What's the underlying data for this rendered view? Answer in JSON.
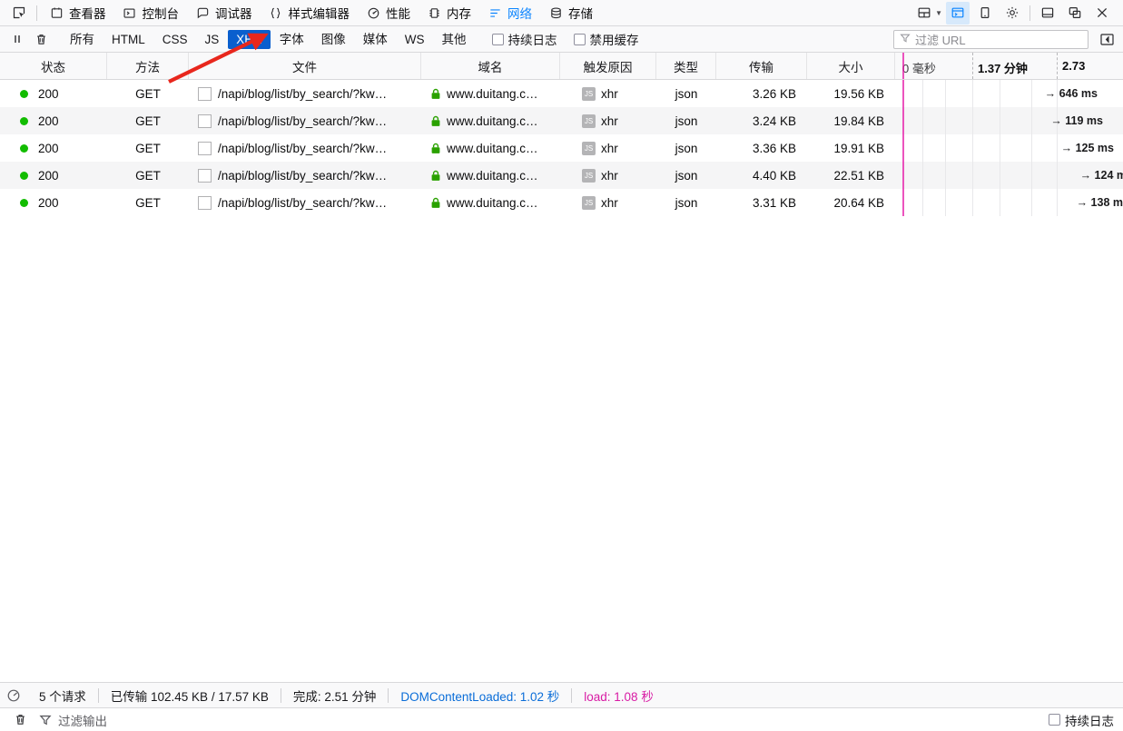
{
  "toolbar": {
    "picker_icon": "element-picker-icon",
    "tabs": [
      {
        "label": "查看器",
        "icon": "inspector-icon",
        "active": false
      },
      {
        "label": "控制台",
        "icon": "console-icon",
        "active": false
      },
      {
        "label": "调试器",
        "icon": "debugger-icon",
        "active": false
      },
      {
        "label": "样式编辑器",
        "icon": "style-editor-icon",
        "active": false
      },
      {
        "label": "性能",
        "icon": "performance-icon",
        "active": false
      },
      {
        "label": "内存",
        "icon": "memory-icon",
        "active": false
      },
      {
        "label": "网络",
        "icon": "network-icon",
        "active": true
      },
      {
        "label": "存储",
        "icon": "storage-icon",
        "active": false
      }
    ],
    "right_icons": [
      {
        "name": "customize-layout-icon",
        "selected": false
      },
      {
        "name": "split-console-icon",
        "selected": true
      },
      {
        "name": "responsive-design-mode-icon",
        "selected": false
      },
      {
        "name": "settings-gear-icon",
        "selected": false
      },
      {
        "name": "dock-to-bottom-icon",
        "selected": false
      },
      {
        "name": "dock-separate-window-icon",
        "selected": false
      },
      {
        "name": "close-icon",
        "selected": false
      }
    ]
  },
  "net_toolbar": {
    "pause_icon": "pause-icon",
    "clear_icon": "trash-clear-icon",
    "filters": [
      {
        "label": "所有",
        "active": false
      },
      {
        "label": "HTML",
        "active": false
      },
      {
        "label": "CSS",
        "active": false
      },
      {
        "label": "JS",
        "active": false
      },
      {
        "label": "XHR",
        "active": true
      },
      {
        "label": "字体",
        "active": false
      },
      {
        "label": "图像",
        "active": false
      },
      {
        "label": "媒体",
        "active": false
      },
      {
        "label": "WS",
        "active": false
      },
      {
        "label": "其他",
        "active": false
      }
    ],
    "checkboxes": [
      {
        "label": "持续日志",
        "checked": false
      },
      {
        "label": "禁用缓存",
        "checked": false
      }
    ],
    "url_filter_placeholder": "过滤 URL",
    "url_filter_value": "",
    "sidebar_toggle_icon": "toggle-sidebar-icon"
  },
  "table": {
    "columns": [
      "状态",
      "方法",
      "文件",
      "域名",
      "触发原因",
      "类型",
      "传输",
      "大小"
    ],
    "timeline_ticks": [
      {
        "label": "0 毫秒",
        "bold": false
      },
      {
        "label": "1.37 分钟",
        "bold": true
      },
      {
        "label": "2.73",
        "bold": true
      }
    ],
    "rows": [
      {
        "status": "200",
        "method": "GET",
        "file": "/napi/blog/list/by_search/?kw…",
        "domain": "www.duitang.c…",
        "cause": "xhr",
        "type": "json",
        "transferred": "3.26 KB",
        "size": "19.56 KB",
        "time": "→ 646 ms",
        "bar_right": 28
      },
      {
        "status": "200",
        "method": "GET",
        "file": "/napi/blog/list/by_search/?kw…",
        "domain": "www.duitang.c…",
        "cause": "xhr",
        "type": "json",
        "transferred": "3.24 KB",
        "size": "19.84 KB",
        "time": "→ 119 ms",
        "bar_right": 22
      },
      {
        "status": "200",
        "method": "GET",
        "file": "/napi/blog/list/by_search/?kw…",
        "domain": "www.duitang.c…",
        "cause": "xhr",
        "type": "json",
        "transferred": "3.36 KB",
        "size": "19.91 KB",
        "time": "→ 125 ms",
        "bar_right": 10
      },
      {
        "status": "200",
        "method": "GET",
        "file": "/napi/blog/list/by_search/?kw…",
        "domain": "www.duitang.c…",
        "cause": "xhr",
        "type": "json",
        "transferred": "4.40 KB",
        "size": "22.51 KB",
        "time": "→ 124 m",
        "bar_right": 0
      },
      {
        "status": "200",
        "method": "GET",
        "file": "/napi/blog/list/by_search/?kw…",
        "domain": "www.duitang.c…",
        "cause": "xhr",
        "type": "json",
        "transferred": "3.31 KB",
        "size": "20.64 KB",
        "time": "→ 138 m",
        "bar_right": 2
      }
    ]
  },
  "status_bar": {
    "analyze_icon": "performance-analysis-icon",
    "requests": "5 个请求",
    "transferred": "已传输 102.45 KB / 17.57 KB",
    "finish": "完成: 2.51 分钟",
    "dom_content_loaded": "DOMContentLoaded: 1.02 秒",
    "load": "load: 1.08 秒"
  },
  "console_bar": {
    "clear_icon": "trash-clear-icon",
    "filter_icon": "filter-funnel-icon",
    "filter_placeholder": "过滤输出",
    "persist_label": "持续日志",
    "persist_checked": false
  },
  "colors": {
    "accent_blue": "#0a84ff",
    "filter_active_blue": "#0a5fce",
    "status_ok_green": "#12bc00",
    "dcl_blue": "#0a6dd8",
    "load_magenta": "#d81ba4",
    "annotation_red": "#e8271d"
  }
}
